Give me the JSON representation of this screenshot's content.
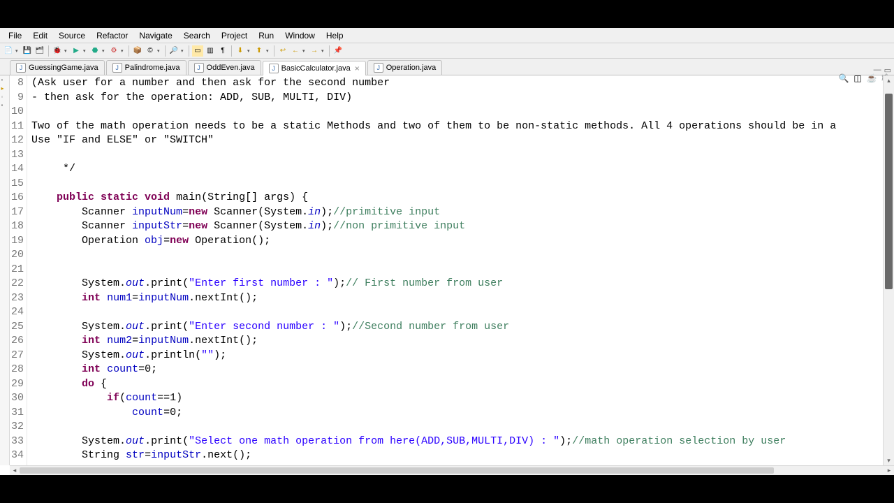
{
  "menu": [
    "File",
    "Edit",
    "Source",
    "Refactor",
    "Navigate",
    "Search",
    "Project",
    "Run",
    "Window",
    "Help"
  ],
  "tabs": [
    {
      "label": "GuessingGame.java",
      "active": false
    },
    {
      "label": "Palindrome.java",
      "active": false
    },
    {
      "label": "OddEven.java",
      "active": false
    },
    {
      "label": "BasicCalculator.java",
      "active": true
    },
    {
      "label": "Operation.java",
      "active": false
    }
  ],
  "line_start": 8,
  "lines": [
    {
      "n": 8,
      "segs": [
        {
          "t": "(Ask user for a number and then ask for the second number"
        }
      ]
    },
    {
      "n": 9,
      "segs": [
        {
          "t": "- then ask for the operation: ADD, SUB, MULTI, DIV)"
        }
      ]
    },
    {
      "n": 10,
      "segs": []
    },
    {
      "n": 11,
      "segs": [
        {
          "t": "Two of the math operation needs to be a static Methods and two of them to be non-static methods. All 4 operations should be in a"
        }
      ]
    },
    {
      "n": 12,
      "segs": [
        {
          "t": "Use \"IF and ELSE\" or \"SWITCH\""
        }
      ]
    },
    {
      "n": 13,
      "segs": []
    },
    {
      "n": 14,
      "segs": [
        {
          "t": "     */"
        }
      ]
    },
    {
      "n": 15,
      "segs": []
    },
    {
      "n": 16,
      "segs": [
        {
          "t": "    "
        },
        {
          "t": "public static void",
          "c": "kw"
        },
        {
          "t": " main(String[] args) {"
        }
      ]
    },
    {
      "n": 17,
      "segs": [
        {
          "t": "        Scanner "
        },
        {
          "t": "inputNum",
          "c": "fld"
        },
        {
          "t": "="
        },
        {
          "t": "new",
          "c": "kw"
        },
        {
          "t": " Scanner(System."
        },
        {
          "t": "in",
          "c": "fld-it"
        },
        {
          "t": ");"
        },
        {
          "t": "//primitive input",
          "c": "cmt"
        }
      ]
    },
    {
      "n": 18,
      "segs": [
        {
          "t": "        Scanner "
        },
        {
          "t": "inputStr",
          "c": "fld"
        },
        {
          "t": "="
        },
        {
          "t": "new",
          "c": "kw"
        },
        {
          "t": " Scanner(System."
        },
        {
          "t": "in",
          "c": "fld-it"
        },
        {
          "t": ");"
        },
        {
          "t": "//non primitive input",
          "c": "cmt"
        }
      ]
    },
    {
      "n": 19,
      "segs": [
        {
          "t": "        Operation "
        },
        {
          "t": "obj",
          "c": "fld"
        },
        {
          "t": "="
        },
        {
          "t": "new",
          "c": "kw"
        },
        {
          "t": " Operation();"
        }
      ]
    },
    {
      "n": 20,
      "segs": []
    },
    {
      "n": 21,
      "segs": []
    },
    {
      "n": 22,
      "segs": [
        {
          "t": "        System."
        },
        {
          "t": "out",
          "c": "fld-it"
        },
        {
          "t": ".print("
        },
        {
          "t": "\"Enter first number : \"",
          "c": "str"
        },
        {
          "t": ");"
        },
        {
          "t": "// First number from user",
          "c": "cmt"
        }
      ]
    },
    {
      "n": 23,
      "segs": [
        {
          "t": "        "
        },
        {
          "t": "int",
          "c": "kw"
        },
        {
          "t": " "
        },
        {
          "t": "num1",
          "c": "fld"
        },
        {
          "t": "="
        },
        {
          "t": "inputNum",
          "c": "fld"
        },
        {
          "t": ".nextInt();"
        }
      ]
    },
    {
      "n": 24,
      "segs": []
    },
    {
      "n": 25,
      "segs": [
        {
          "t": "        System."
        },
        {
          "t": "out",
          "c": "fld-it"
        },
        {
          "t": ".print("
        },
        {
          "t": "\"Enter second number : \"",
          "c": "str"
        },
        {
          "t": ");"
        },
        {
          "t": "//Second number from user",
          "c": "cmt"
        }
      ]
    },
    {
      "n": 26,
      "segs": [
        {
          "t": "        "
        },
        {
          "t": "int",
          "c": "kw"
        },
        {
          "t": " "
        },
        {
          "t": "num2",
          "c": "fld"
        },
        {
          "t": "="
        },
        {
          "t": "inputNum",
          "c": "fld"
        },
        {
          "t": ".nextInt();"
        }
      ]
    },
    {
      "n": 27,
      "segs": [
        {
          "t": "        System."
        },
        {
          "t": "out",
          "c": "fld-it"
        },
        {
          "t": ".println("
        },
        {
          "t": "\"\"",
          "c": "str"
        },
        {
          "t": ");"
        }
      ]
    },
    {
      "n": 28,
      "segs": [
        {
          "t": "        "
        },
        {
          "t": "int",
          "c": "kw"
        },
        {
          "t": " "
        },
        {
          "t": "count",
          "c": "fld"
        },
        {
          "t": "=0;"
        }
      ]
    },
    {
      "n": 29,
      "segs": [
        {
          "t": "        "
        },
        {
          "t": "do",
          "c": "kw"
        },
        {
          "t": " {"
        }
      ]
    },
    {
      "n": 30,
      "segs": [
        {
          "t": "            "
        },
        {
          "t": "if",
          "c": "kw"
        },
        {
          "t": "("
        },
        {
          "t": "count",
          "c": "fld"
        },
        {
          "t": "==1)"
        }
      ]
    },
    {
      "n": 31,
      "segs": [
        {
          "t": "                "
        },
        {
          "t": "count",
          "c": "fld"
        },
        {
          "t": "=0;"
        }
      ]
    },
    {
      "n": 32,
      "segs": []
    },
    {
      "n": 33,
      "segs": [
        {
          "t": "        System."
        },
        {
          "t": "out",
          "c": "fld-it"
        },
        {
          "t": ".print("
        },
        {
          "t": "\"Select one math operation from here(ADD,SUB,MULTI,DIV) : \"",
          "c": "str"
        },
        {
          "t": ");"
        },
        {
          "t": "//math operation selection by user",
          "c": "cmt"
        }
      ]
    },
    {
      "n": 34,
      "segs": [
        {
          "t": "        String "
        },
        {
          "t": "str",
          "c": "fld"
        },
        {
          "t": "="
        },
        {
          "t": "inputStr",
          "c": "fld"
        },
        {
          "t": ".next();"
        }
      ]
    }
  ]
}
